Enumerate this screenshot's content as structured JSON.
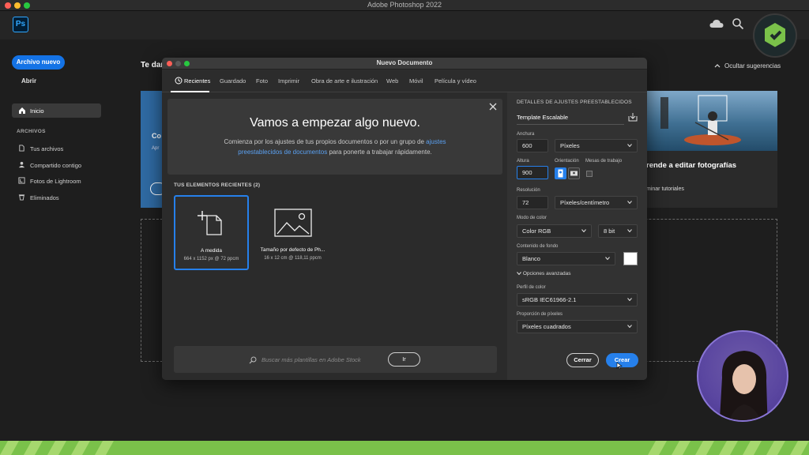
{
  "window": {
    "title": "Adobe Photoshop 2022"
  },
  "app": {
    "logo_text": "Ps",
    "new_file_label": "Archivo nuevo",
    "open_label": "Abrir",
    "home_label": "Inicio",
    "files_section": "ARCHIVOS",
    "sidebar_items": [
      {
        "label": "Tus archivos",
        "icon": "file-icon"
      },
      {
        "label": "Compartido contigo",
        "icon": "people-icon"
      },
      {
        "label": "Fotos de Lightroom",
        "icon": "lightroom-icon"
      },
      {
        "label": "Eliminados",
        "icon": "trash-icon"
      }
    ],
    "welcome_partial": "Te dar",
    "hide_suggestions": "Ocultar sugerencias",
    "card_title_partial": "rende a editar fotografías",
    "card_link_partial": "minar tutoriales",
    "blue_card_partial": "Co",
    "blue_card_sub_partial": "Apr"
  },
  "dialog": {
    "title": "Nuevo Documento",
    "tabs": [
      "Recientes",
      "Guardado",
      "Foto",
      "Imprimir",
      "Obra de arte e ilustración",
      "Web",
      "Móvil",
      "Película y vídeo"
    ],
    "active_tab": "Recientes",
    "hero_title": "Vamos a empezar algo nuevo.",
    "hero_text_1": "Comienza por los ajustes de tus propios documentos o por un grupo de ",
    "hero_link_1": "ajustes",
    "hero_link_2": "preestablecidos de documentos",
    "hero_text_2": " para ponerte a trabajar rápidamente.",
    "recent_label": "TUS ELEMENTOS RECIENTES  (2)",
    "recent_items": [
      {
        "name": "A medida",
        "detail": "664 x 1152 px @ 72 ppcm"
      },
      {
        "name": "Tamaño por defecto de Ph...",
        "detail": "16 x 12 cm @ 118,11 ppcm"
      }
    ],
    "stock_placeholder": "Buscar más plantillas en Adobe Stock",
    "stock_go": "Ir",
    "details": {
      "header": "DETALLES DE AJUSTES PREESTABLECIDOS",
      "preset_name": "Template Escalable",
      "width_label": "Anchura",
      "width_value": "600",
      "width_unit": "Píxeles",
      "height_label": "Altura",
      "height_value": "900",
      "orientation_label": "Orientación",
      "artboards_label": "Mesas de trabajo",
      "resolution_label": "Resolución",
      "resolution_value": "72",
      "resolution_unit": "Píxeles/centímetro",
      "color_mode_label": "Modo de color",
      "color_mode_value": "Color RGB",
      "bit_depth": "8 bit",
      "background_label": "Contenido de fondo",
      "background_value": "Blanco",
      "advanced_label": "Opciones avanzadas",
      "color_profile_label": "Perfil de color",
      "color_profile_value": "sRGB IEC61966-2.1",
      "pixel_ratio_label": "Proporción de píxeles",
      "pixel_ratio_value": "Píxeles cuadrados"
    },
    "cancel_label": "Cerrar",
    "create_label": "Crear"
  },
  "colors": {
    "accent": "#2680eb",
    "new_button": "#1473e6",
    "band": "#7ac14a",
    "background": "#1e1e1e"
  }
}
